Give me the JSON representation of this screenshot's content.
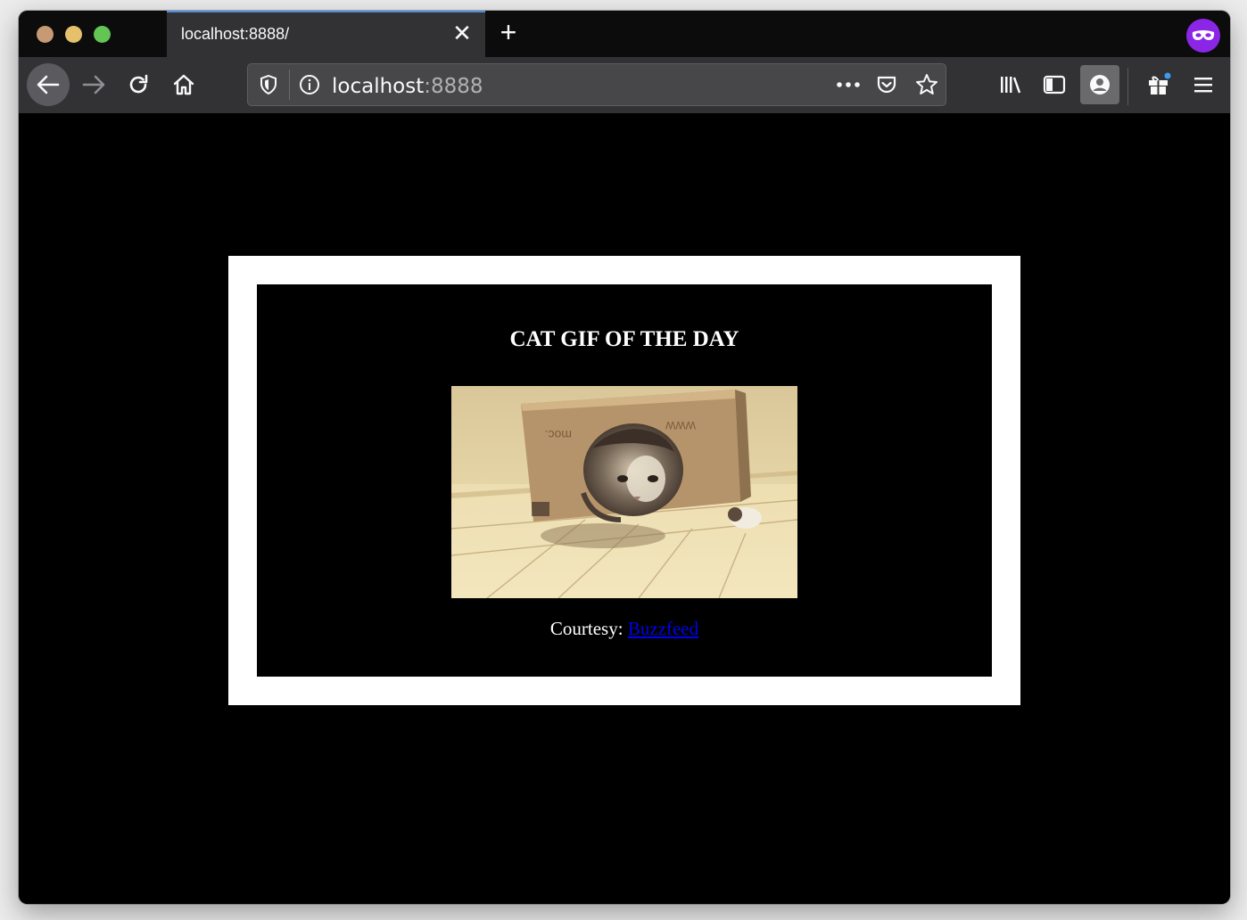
{
  "browser": {
    "tab": {
      "title": "localhost:8888/",
      "close_glyph": "✕"
    },
    "new_tab_glyph": "+",
    "url": {
      "host": "localhost",
      "port": ":8888"
    },
    "icons": {
      "private": "private-browsing-mask-icon",
      "back": "back-arrow-icon",
      "forward": "forward-arrow-icon",
      "reload": "reload-icon",
      "home": "home-icon",
      "tracking": "shield-icon",
      "info": "info-icon",
      "page_actions": "more-dots-icon",
      "pocket": "pocket-icon",
      "bookmark": "star-icon",
      "library": "library-icon",
      "sidebar": "sidebar-icon",
      "account": "account-icon",
      "extensions": "gift-icon",
      "menu": "hamburger-menu-icon"
    },
    "colors": {
      "tab_accent": "#4c8de0",
      "private": "#8b26e6"
    }
  },
  "page": {
    "headline": "CAT GIF OF THE DAY",
    "image_alt": "cat-in-box-gif",
    "courtesy_label": "Courtesy:",
    "courtesy_link": "Buzzfeed"
  }
}
